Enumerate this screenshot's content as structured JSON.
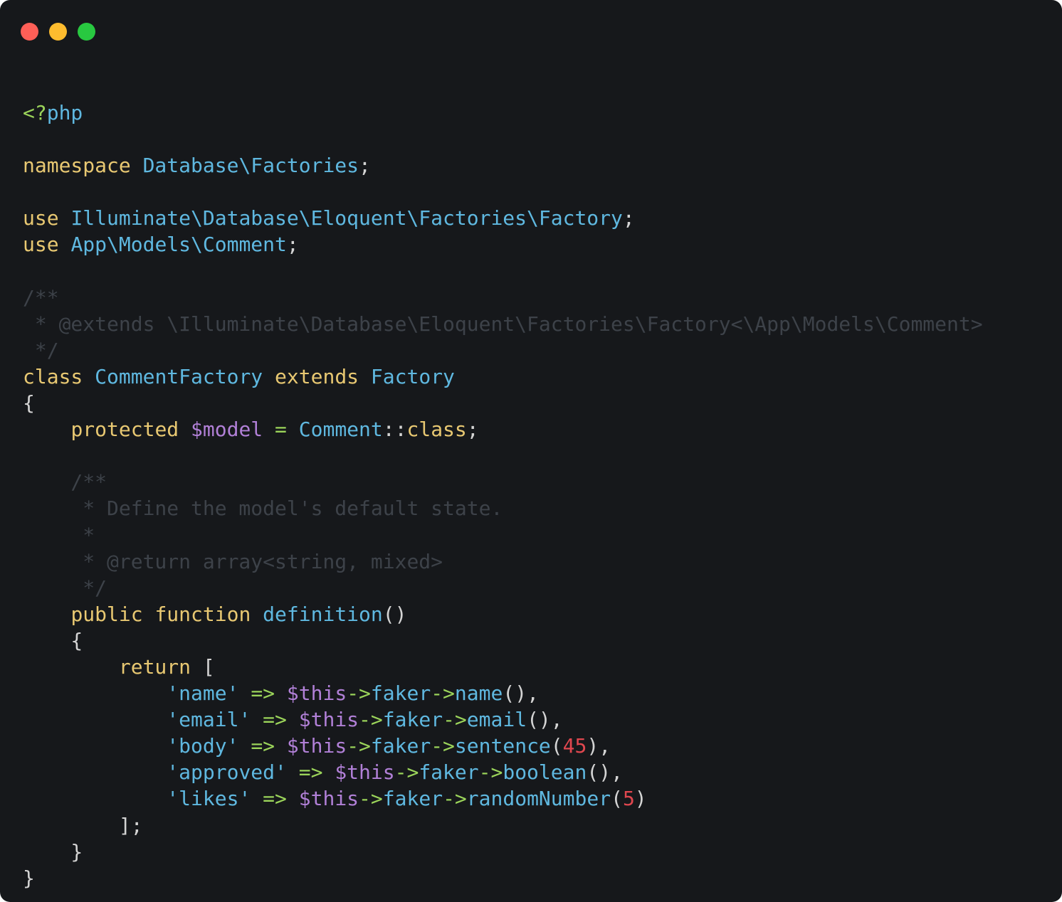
{
  "window": {
    "controls": {
      "close_color": "#fe5f57",
      "minimize_color": "#febc2e",
      "maximize_color": "#28c840"
    }
  },
  "code": {
    "language": "php",
    "lines": [
      [
        {
          "t": "<?",
          "c": "pl"
        },
        {
          "t": "php",
          "c": "ty"
        }
      ],
      [],
      [
        {
          "t": "namespace",
          "c": "kw"
        },
        {
          "t": " ",
          "c": "p"
        },
        {
          "t": "Database\\Factories",
          "c": "ty"
        },
        {
          "t": ";",
          "c": "p"
        }
      ],
      [],
      [
        {
          "t": "use",
          "c": "kw"
        },
        {
          "t": " ",
          "c": "p"
        },
        {
          "t": "Illuminate\\Database\\Eloquent\\Factories\\Factory",
          "c": "ty"
        },
        {
          "t": ";",
          "c": "p"
        }
      ],
      [
        {
          "t": "use",
          "c": "kw"
        },
        {
          "t": " ",
          "c": "p"
        },
        {
          "t": "App\\Models\\Comment",
          "c": "ty"
        },
        {
          "t": ";",
          "c": "p"
        }
      ],
      [],
      [
        {
          "t": "/**",
          "c": "cm"
        }
      ],
      [
        {
          "t": " * @extends \\Illuminate\\Database\\Eloquent\\Factories\\Factory<\\App\\Models\\Comment>",
          "c": "cm"
        }
      ],
      [
        {
          "t": " */",
          "c": "cm"
        }
      ],
      [
        {
          "t": "class",
          "c": "kw"
        },
        {
          "t": " ",
          "c": "p"
        },
        {
          "t": "CommentFactory",
          "c": "ty"
        },
        {
          "t": " ",
          "c": "p"
        },
        {
          "t": "extends",
          "c": "kw"
        },
        {
          "t": " ",
          "c": "p"
        },
        {
          "t": "Factory",
          "c": "ty"
        }
      ],
      [
        {
          "t": "{",
          "c": "p"
        }
      ],
      [
        {
          "t": "    ",
          "c": "p"
        },
        {
          "t": "protected",
          "c": "kw"
        },
        {
          "t": " ",
          "c": "p"
        },
        {
          "t": "$model",
          "c": "var"
        },
        {
          "t": " ",
          "c": "p"
        },
        {
          "t": "=",
          "c": "op"
        },
        {
          "t": " ",
          "c": "p"
        },
        {
          "t": "Comment",
          "c": "ty"
        },
        {
          "t": "::",
          "c": "p"
        },
        {
          "t": "class",
          "c": "kw"
        },
        {
          "t": ";",
          "c": "p"
        }
      ],
      [],
      [
        {
          "t": "    /**",
          "c": "cm"
        }
      ],
      [
        {
          "t": "     * Define the model's default state.",
          "c": "cm"
        }
      ],
      [
        {
          "t": "     *",
          "c": "cm"
        }
      ],
      [
        {
          "t": "     * @return array<string, mixed>",
          "c": "cm"
        }
      ],
      [
        {
          "t": "     */",
          "c": "cm"
        }
      ],
      [
        {
          "t": "    ",
          "c": "p"
        },
        {
          "t": "public",
          "c": "kw"
        },
        {
          "t": " ",
          "c": "p"
        },
        {
          "t": "function",
          "c": "kw"
        },
        {
          "t": " ",
          "c": "p"
        },
        {
          "t": "definition",
          "c": "fn"
        },
        {
          "t": "()",
          "c": "p"
        }
      ],
      [
        {
          "t": "    {",
          "c": "p"
        }
      ],
      [
        {
          "t": "        ",
          "c": "p"
        },
        {
          "t": "return",
          "c": "kw"
        },
        {
          "t": " [",
          "c": "p"
        }
      ],
      [
        {
          "t": "            ",
          "c": "p"
        },
        {
          "t": "'name'",
          "c": "str"
        },
        {
          "t": " ",
          "c": "p"
        },
        {
          "t": "=>",
          "c": "op"
        },
        {
          "t": " ",
          "c": "p"
        },
        {
          "t": "$this",
          "c": "var"
        },
        {
          "t": "->",
          "c": "op"
        },
        {
          "t": "faker",
          "c": "fn"
        },
        {
          "t": "->",
          "c": "op"
        },
        {
          "t": "name",
          "c": "fn"
        },
        {
          "t": "(),",
          "c": "p"
        }
      ],
      [
        {
          "t": "            ",
          "c": "p"
        },
        {
          "t": "'email'",
          "c": "str"
        },
        {
          "t": " ",
          "c": "p"
        },
        {
          "t": "=>",
          "c": "op"
        },
        {
          "t": " ",
          "c": "p"
        },
        {
          "t": "$this",
          "c": "var"
        },
        {
          "t": "->",
          "c": "op"
        },
        {
          "t": "faker",
          "c": "fn"
        },
        {
          "t": "->",
          "c": "op"
        },
        {
          "t": "email",
          "c": "fn"
        },
        {
          "t": "(),",
          "c": "p"
        }
      ],
      [
        {
          "t": "            ",
          "c": "p"
        },
        {
          "t": "'body'",
          "c": "str"
        },
        {
          "t": " ",
          "c": "p"
        },
        {
          "t": "=>",
          "c": "op"
        },
        {
          "t": " ",
          "c": "p"
        },
        {
          "t": "$this",
          "c": "var"
        },
        {
          "t": "->",
          "c": "op"
        },
        {
          "t": "faker",
          "c": "fn"
        },
        {
          "t": "->",
          "c": "op"
        },
        {
          "t": "sentence",
          "c": "fn"
        },
        {
          "t": "(",
          "c": "p"
        },
        {
          "t": "45",
          "c": "num"
        },
        {
          "t": "),",
          "c": "p"
        }
      ],
      [
        {
          "t": "            ",
          "c": "p"
        },
        {
          "t": "'approved'",
          "c": "str"
        },
        {
          "t": " ",
          "c": "p"
        },
        {
          "t": "=>",
          "c": "op"
        },
        {
          "t": " ",
          "c": "p"
        },
        {
          "t": "$this",
          "c": "var"
        },
        {
          "t": "->",
          "c": "op"
        },
        {
          "t": "faker",
          "c": "fn"
        },
        {
          "t": "->",
          "c": "op"
        },
        {
          "t": "boolean",
          "c": "fn"
        },
        {
          "t": "(),",
          "c": "p"
        }
      ],
      [
        {
          "t": "            ",
          "c": "p"
        },
        {
          "t": "'likes'",
          "c": "str"
        },
        {
          "t": " ",
          "c": "p"
        },
        {
          "t": "=>",
          "c": "op"
        },
        {
          "t": " ",
          "c": "p"
        },
        {
          "t": "$this",
          "c": "var"
        },
        {
          "t": "->",
          "c": "op"
        },
        {
          "t": "faker",
          "c": "fn"
        },
        {
          "t": "->",
          "c": "op"
        },
        {
          "t": "randomNumber",
          "c": "fn"
        },
        {
          "t": "(",
          "c": "p"
        },
        {
          "t": "5",
          "c": "num"
        },
        {
          "t": ")",
          "c": "p"
        }
      ],
      [
        {
          "t": "        ];",
          "c": "p"
        }
      ],
      [
        {
          "t": "    }",
          "c": "p"
        }
      ],
      [
        {
          "t": "}",
          "c": "p"
        }
      ]
    ]
  }
}
